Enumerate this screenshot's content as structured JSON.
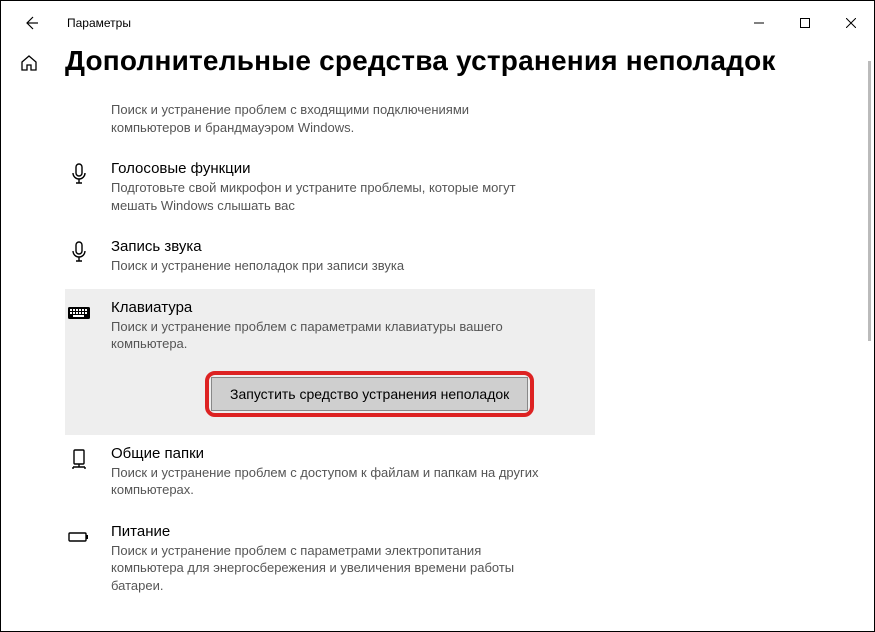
{
  "window": {
    "title": "Параметры"
  },
  "page": {
    "heading": "Дополнительные средства устранения неполадок"
  },
  "items": {
    "incoming": {
      "desc": "Поиск и устранение проблем с входящими подключениями компьютеров и брандмауэром Windows."
    },
    "speech": {
      "title": "Голосовые функции",
      "desc": "Подготовьте свой микрофон и устраните проблемы, которые могут мешать Windows слышать вас"
    },
    "recording": {
      "title": "Запись звука",
      "desc": "Поиск и устранение неполадок при записи звука"
    },
    "keyboard": {
      "title": "Клавиатура",
      "desc": "Поиск и устранение проблем с параметрами клавиатуры вашего компьютера.",
      "run": "Запустить средство устранения неполадок"
    },
    "sharedfolders": {
      "title": "Общие папки",
      "desc": "Поиск и устранение проблем с доступом к файлам и папкам на других компьютерах."
    },
    "power": {
      "title": "Питание",
      "desc": "Поиск и устранение проблем с параметрами электропитания компьютера для энергосбережения и увеличения  времени работы батареи."
    }
  }
}
